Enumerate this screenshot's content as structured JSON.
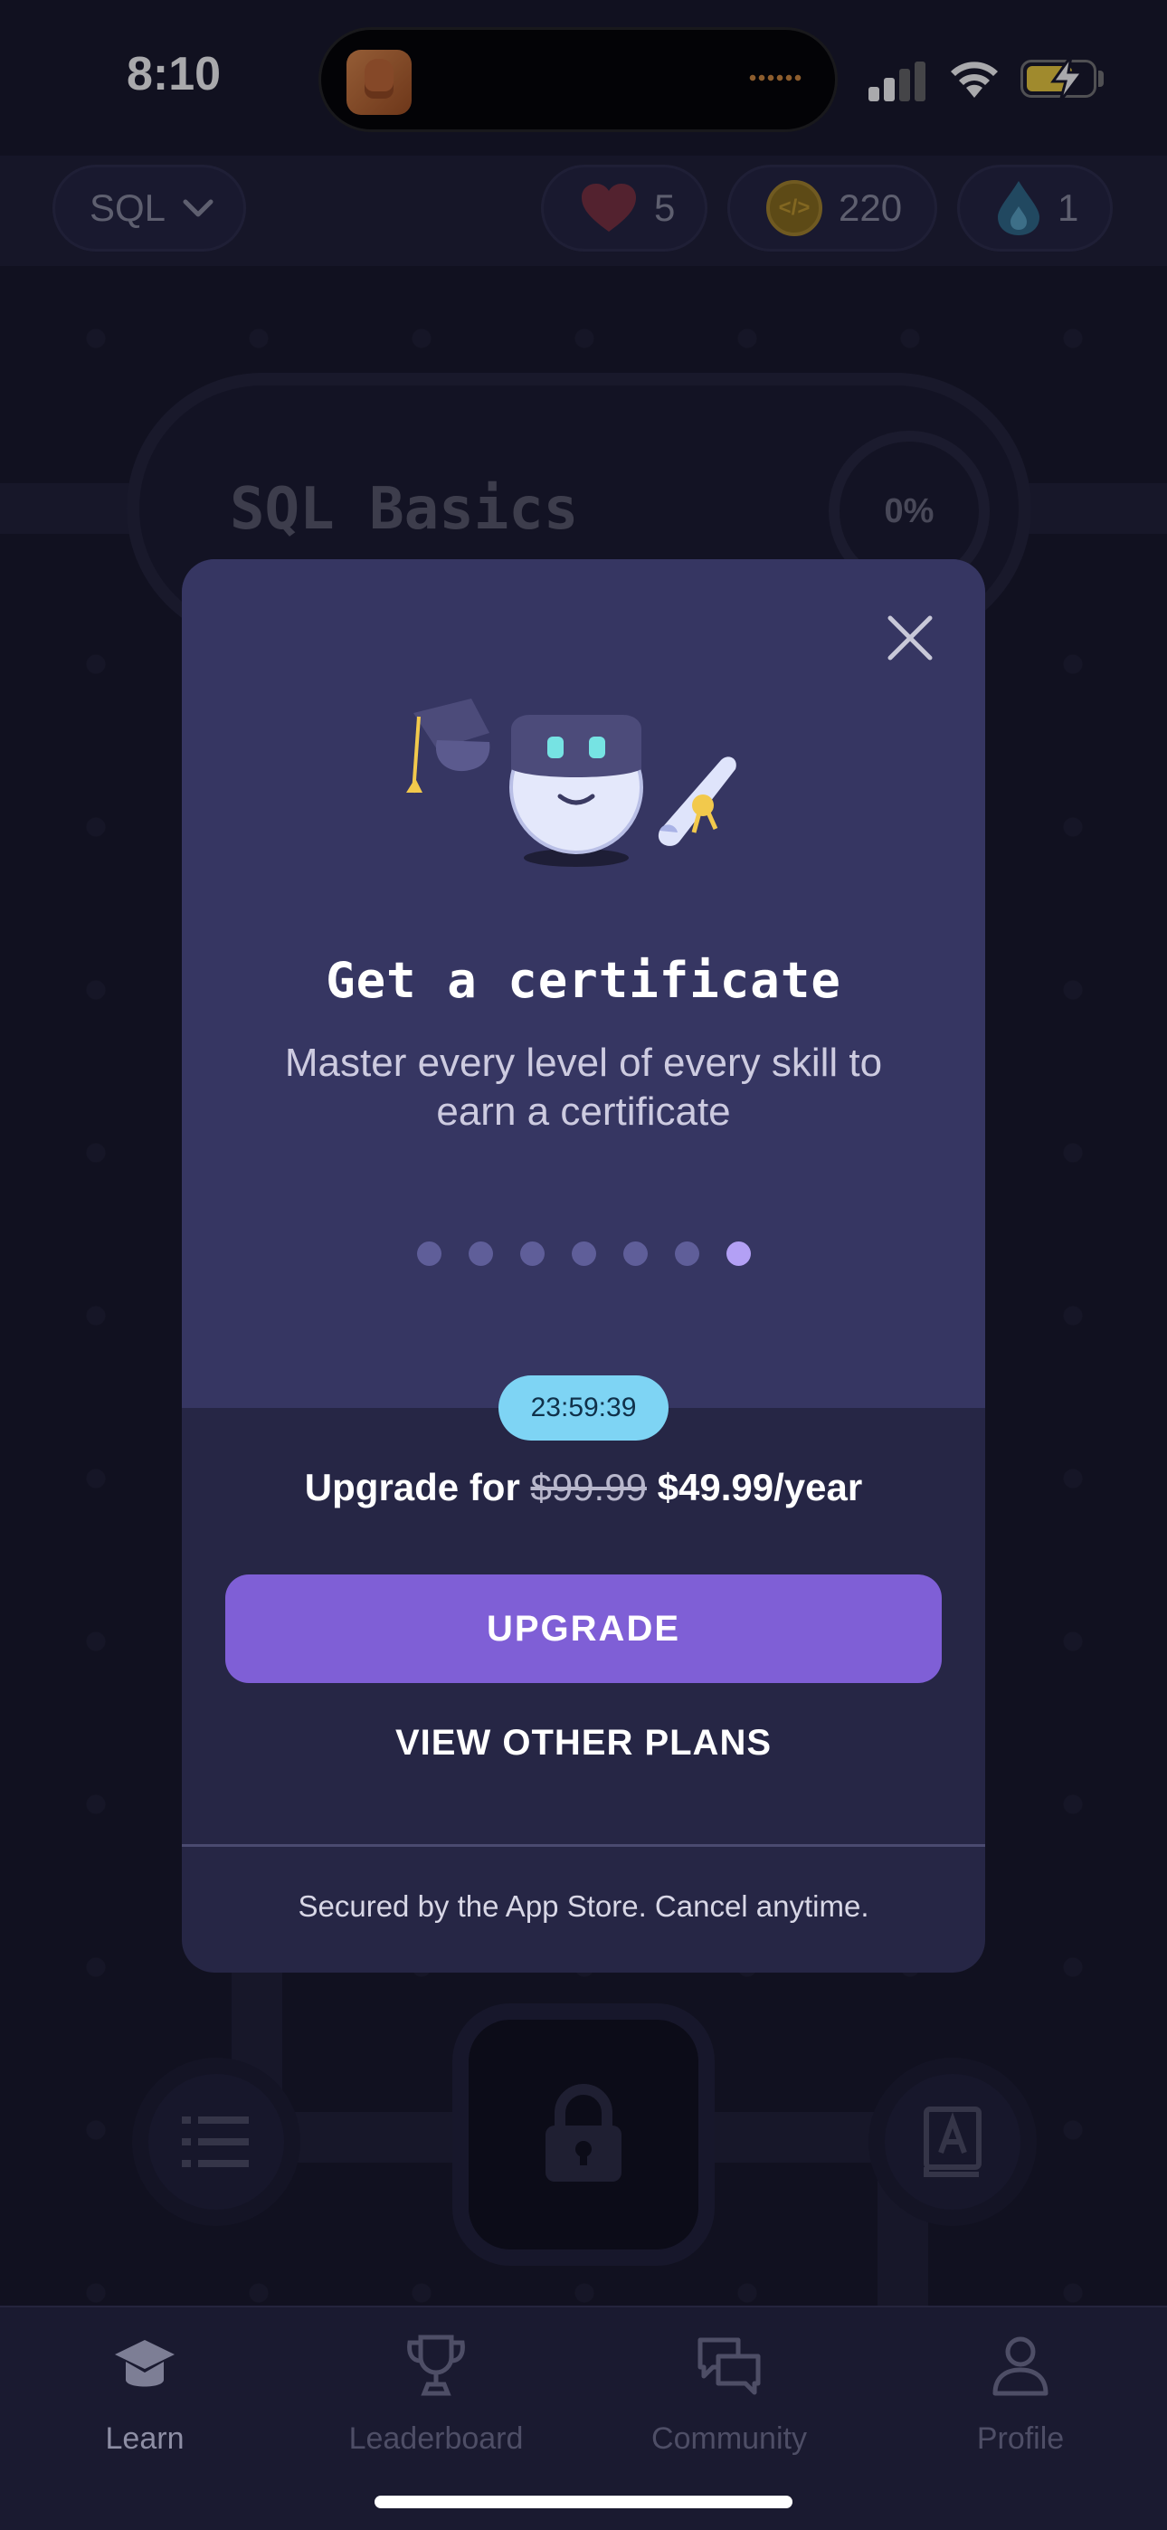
{
  "status_bar": {
    "time": "8:10"
  },
  "header": {
    "course": "SQL",
    "hearts": "5",
    "coins": "220",
    "streak": "1"
  },
  "unit": {
    "title": "SQL Basics",
    "progress": "0%"
  },
  "modal": {
    "title": "Get a certificate",
    "subtitle": "Master every level of every skill to earn a certificate",
    "carousel": {
      "count": 7,
      "active_index": 6
    },
    "timer": "23:59:39",
    "price_prefix": "Upgrade for",
    "old_price": "$99.99",
    "new_price": "$49.99/year",
    "upgrade_label": "UPGRADE",
    "other_plans_label": "VIEW OTHER PLANS",
    "footer": "Secured by the App Store. Cancel anytime."
  },
  "nav": {
    "tabs": [
      {
        "label": "Learn",
        "icon": "graduation-cap-icon",
        "active": true
      },
      {
        "label": "Leaderboard",
        "icon": "trophy-icon",
        "active": false
      },
      {
        "label": "Community",
        "icon": "chat-bubbles-icon",
        "active": false
      },
      {
        "label": "Profile",
        "icon": "person-icon",
        "active": false
      }
    ]
  },
  "colors": {
    "background": "#161628",
    "modal_top": "#363662",
    "modal_bottom": "#262645",
    "accent": "#7f5fd6",
    "timer": "#7ed4f4",
    "dot_active": "#b3a0f5"
  }
}
